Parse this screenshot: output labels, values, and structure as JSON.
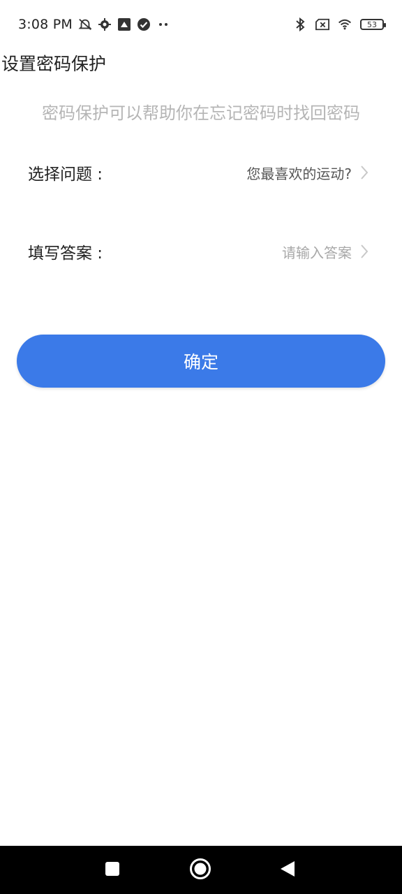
{
  "status_bar": {
    "time": "3:08 PM",
    "left_icons": [
      "mute-bell-icon",
      "gear-icon",
      "screenshot-icon",
      "check-circle-icon",
      "more-dots-icon"
    ],
    "right_icons": [
      "bluetooth-icon",
      "sim-x-icon",
      "wifi-icon"
    ],
    "battery_level": "53"
  },
  "page": {
    "title": "设置密码保护",
    "subtitle": "密码保护可以帮助你在忘记密码时找回密码"
  },
  "form": {
    "question": {
      "label": "选择问题 :",
      "value": "您最喜欢的运动?"
    },
    "answer": {
      "label": "填写答案 :",
      "placeholder": "请输入答案"
    }
  },
  "confirm_button": {
    "label": "确定",
    "color": "#3b7ae8"
  },
  "nav_bar": {
    "buttons": [
      "recents-icon",
      "home-icon",
      "back-icon"
    ]
  }
}
